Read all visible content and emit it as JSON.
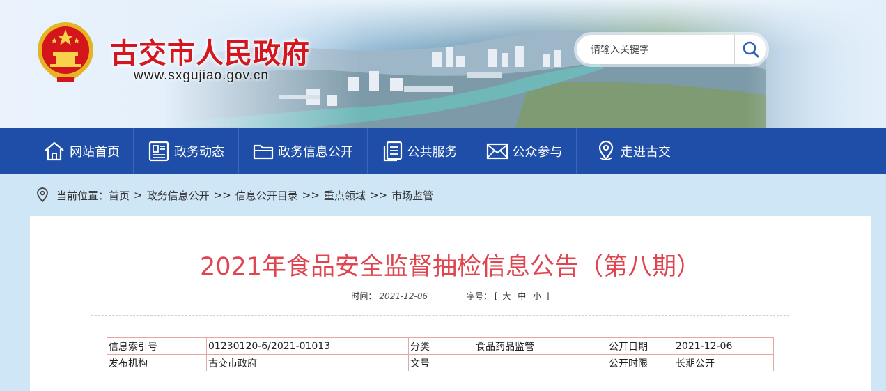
{
  "header": {
    "site_title": "古交市人民政府",
    "site_url": "www.sxgujiao.gov.cn",
    "search_placeholder": "请输入关键字"
  },
  "nav": {
    "items": [
      {
        "label": "网站首页",
        "icon": "home-icon"
      },
      {
        "label": "政务动态",
        "icon": "news-icon"
      },
      {
        "label": "政务信息公开",
        "icon": "folder-icon"
      },
      {
        "label": "公共服务",
        "icon": "document-icon"
      },
      {
        "label": "公众参与",
        "icon": "mail-icon"
      },
      {
        "label": "走进古交",
        "icon": "location-icon"
      }
    ]
  },
  "breadcrumb": {
    "prefix": "当前位置：",
    "items": [
      "首页",
      "政务信息公开",
      "信息公开目录",
      "重点领域",
      "市场监管"
    ],
    "separators": [
      ">",
      ">>",
      ">>",
      ">>"
    ]
  },
  "article": {
    "title": "2021年食品安全监督抽检信息公告（第八期）",
    "time_label": "时间：",
    "date": "2021-12-06",
    "font_size_label": "字号：",
    "bracket_open": "[",
    "sizes": [
      "大",
      "中",
      "小"
    ],
    "bracket_close": "]"
  },
  "info_table": {
    "row1": {
      "index_label": "信息索引号",
      "index_value": "01230120-6/2021-01013",
      "category_label": "分类",
      "category_value": "食品药品监管",
      "date_label": "公开日期",
      "date_value": "2021-12-06"
    },
    "row2": {
      "org_label": "发布机构",
      "org_value": "古交市政府",
      "doc_label": "文号",
      "doc_value": "",
      "term_label": "公开时限",
      "term_value": "长期公开"
    }
  },
  "colors": {
    "nav_bg": "#1e4ea8",
    "title_red": "#e0454f",
    "site_title_red": "#d3161f",
    "page_bg": "#cfe6f7",
    "table_border": "#e2a6a6"
  }
}
